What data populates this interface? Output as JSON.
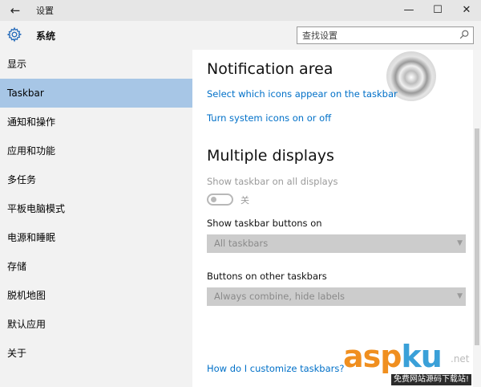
{
  "window": {
    "title": "设置",
    "back_glyph": "←",
    "minimize_glyph": "—",
    "maximize_glyph": "☐",
    "close_glyph": "✕"
  },
  "sidebar": {
    "header": "系统",
    "items": [
      {
        "label": "显示"
      },
      {
        "label": "Taskbar",
        "selected": true
      },
      {
        "label": "通知和操作"
      },
      {
        "label": "应用和功能"
      },
      {
        "label": "多任务"
      },
      {
        "label": "平板电脑模式"
      },
      {
        "label": "电源和睡眠"
      },
      {
        "label": "存储"
      },
      {
        "label": "脱机地图"
      },
      {
        "label": "默认应用"
      },
      {
        "label": "关于"
      }
    ]
  },
  "search": {
    "placeholder": "查找设置"
  },
  "content": {
    "notification_area": {
      "heading": "Notification area",
      "link_icons": "Select which icons appear on the taskbar",
      "link_system_icons": "Turn system icons on or off"
    },
    "multiple_displays": {
      "heading": "Multiple displays",
      "show_all_label": "Show taskbar on all displays",
      "toggle_state": "关",
      "buttons_on_label": "Show taskbar buttons on",
      "buttons_on_value": "All taskbars",
      "other_taskbars_label": "Buttons on other taskbars",
      "other_taskbars_value": "Always combine, hide labels"
    },
    "help_link": "How do I customize taskbars?"
  },
  "watermark": {
    "brand_a": "asp",
    "brand_b": "ku",
    "brand_suffix": ".net",
    "sub": "免费网站源码下载站!"
  },
  "colors": {
    "accent_link": "#0070c8",
    "selected_nav": "#a7c6e6",
    "sidebar_bg": "#f2f2f2",
    "titlebar_bg": "#e6e6e6"
  },
  "icons": [
    "back-arrow-icon",
    "gear-icon",
    "search-icon",
    "chevron-down-icon",
    "minimize-icon",
    "maximize-icon",
    "close-icon"
  ]
}
